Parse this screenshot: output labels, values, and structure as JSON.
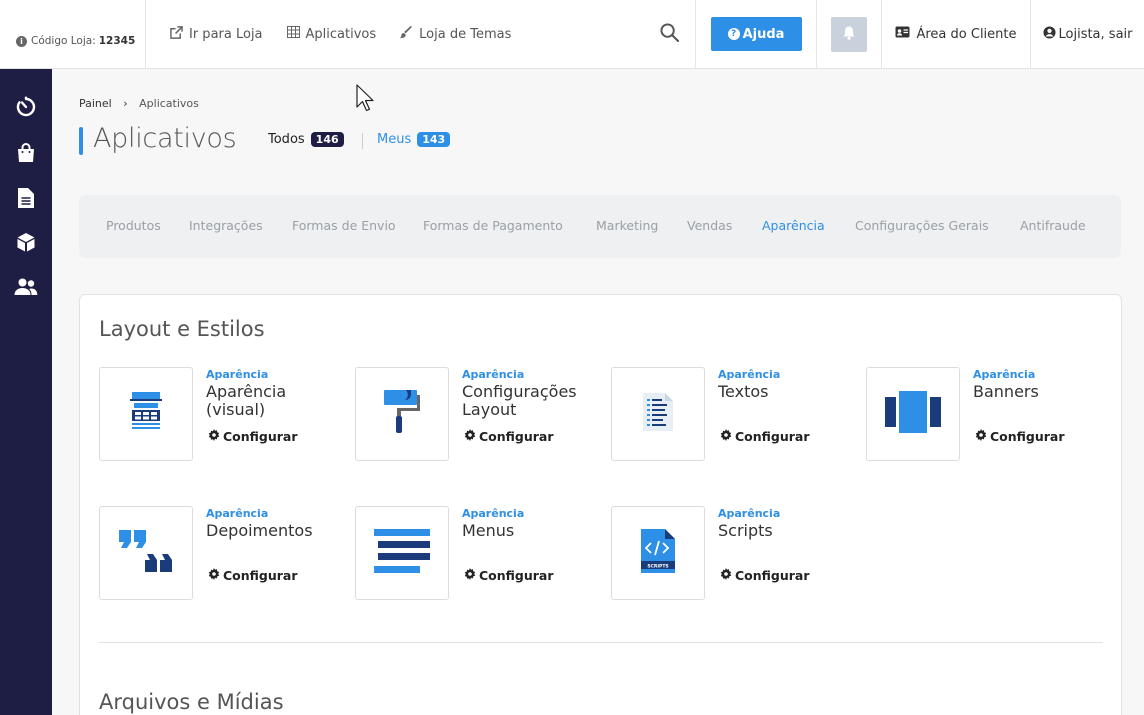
{
  "topbar": {
    "store_code_label": "Código Loja:",
    "store_code_value": "12345",
    "links": [
      {
        "label": "Ir para Loja",
        "icon": "external-link-icon"
      },
      {
        "label": "Aplicativos",
        "icon": "grid-icon"
      },
      {
        "label": "Loja de Temas",
        "icon": "paint-brush-icon"
      }
    ],
    "help_label": "Ajuda",
    "client_area_label": "Área do Cliente",
    "user_label": "Lojista, sair"
  },
  "sidebar": {
    "items": [
      {
        "name": "dashboard",
        "icon": "timer-icon"
      },
      {
        "name": "orders",
        "icon": "shopping-bag-icon"
      },
      {
        "name": "pages",
        "icon": "document-icon"
      },
      {
        "name": "products",
        "icon": "box-icon"
      },
      {
        "name": "customers",
        "icon": "users-icon"
      }
    ]
  },
  "breadcrumb": {
    "root": "Painel",
    "current": "Aplicativos"
  },
  "page": {
    "title": "Aplicativos",
    "filter_all_label": "Todos",
    "filter_all_count": "146",
    "filter_mine_label": "Meus",
    "filter_mine_count": "143"
  },
  "categories": [
    {
      "label": "Produtos",
      "active": false
    },
    {
      "label": "Integrações",
      "active": false
    },
    {
      "label": "Formas de Envio",
      "active": false
    },
    {
      "label": "Formas de Pagamento",
      "active": false
    },
    {
      "label": "Marketing",
      "active": false
    },
    {
      "label": "Vendas",
      "active": false
    },
    {
      "label": "Aparência",
      "active": true
    },
    {
      "label": "Configurações Gerais",
      "active": false
    },
    {
      "label": "Antifraude",
      "active": false
    }
  ],
  "sections": [
    {
      "title": "Layout e Estilos",
      "apps": [
        {
          "category": "Aparência",
          "name": "Aparência (visual)",
          "config_label": "Configurar",
          "icon": "layout-grid-icon"
        },
        {
          "category": "Aparência",
          "name": "Configurações Layout",
          "config_label": "Configurar",
          "icon": "paint-roller-icon"
        },
        {
          "category": "Aparência",
          "name": "Textos",
          "config_label": "Configurar",
          "icon": "text-document-icon"
        },
        {
          "category": "Aparência",
          "name": "Banners",
          "config_label": "Configurar",
          "icon": "banner-slides-icon"
        },
        {
          "category": "Aparência",
          "name": "Depoimentos",
          "config_label": "Configurar",
          "icon": "quotes-icon"
        },
        {
          "category": "Aparência",
          "name": "Menus",
          "config_label": "Configurar",
          "icon": "menu-lines-icon"
        },
        {
          "category": "Aparência",
          "name": "Scripts",
          "config_label": "Configurar",
          "icon": "code-file-icon"
        }
      ]
    },
    {
      "title": "Arquivos e Mídias",
      "apps": []
    }
  ],
  "colors": {
    "accent": "#2e8fe6",
    "sidebar": "#1e1e45",
    "badge_dark": "#1e1e45",
    "icon_blue": "#2e8fe6",
    "icon_navy": "#1b3c7a"
  }
}
